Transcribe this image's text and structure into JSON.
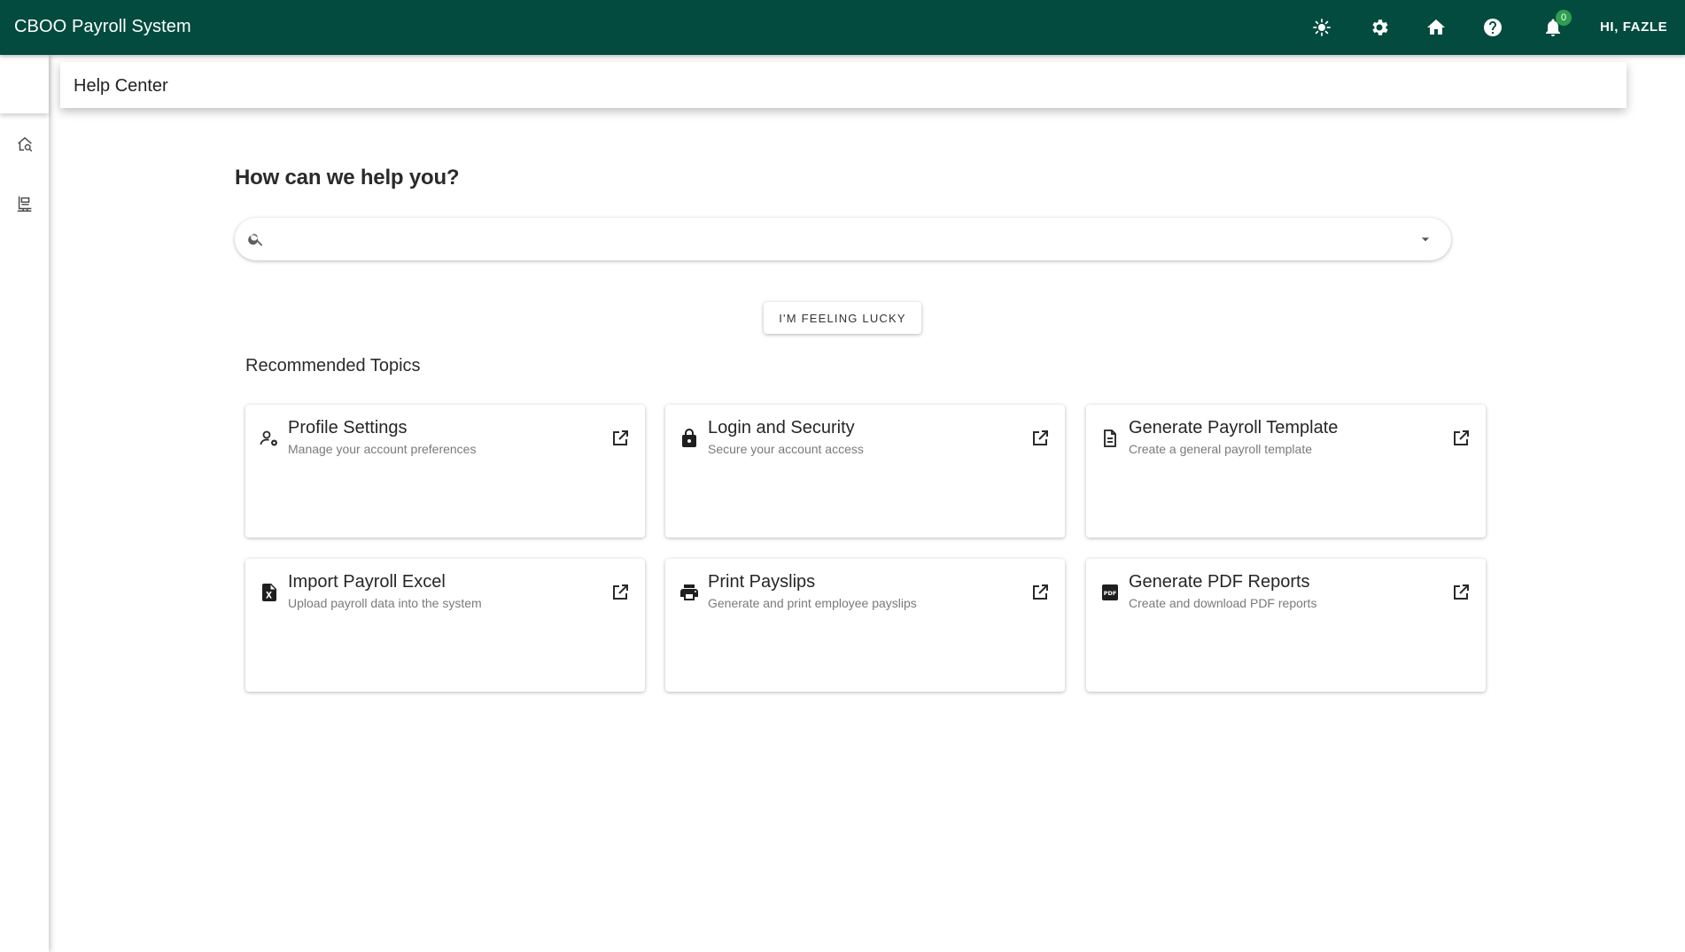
{
  "app": {
    "title": "CBOO Payroll System",
    "brand_color": "#024b3e"
  },
  "topbar": {
    "icons": [
      "theme-brightness-icon",
      "settings-gear-icon",
      "home-icon",
      "help-icon",
      "notifications-bell-icon"
    ],
    "notification_count": "0",
    "user_greeting": "HI, FAZLE"
  },
  "left_rail": {
    "icons": [
      "home-search-icon",
      "payroll-report-icon"
    ]
  },
  "breadcrumb": {
    "title": "Help Center"
  },
  "main": {
    "heading": "How can we help you?",
    "search": {
      "value": "",
      "placeholder": ""
    },
    "lucky_button_label": "I'M FEELING LUCKY",
    "topics_heading": "Recommended Topics",
    "topics": [
      {
        "title": "Profile Settings",
        "description": "Manage your account preferences",
        "icon": "profile-settings-icon"
      },
      {
        "title": "Login and Security",
        "description": "Secure your account access",
        "icon": "lock-icon"
      },
      {
        "title": "Generate Payroll Template",
        "description": "Create a general payroll template",
        "icon": "document-icon"
      },
      {
        "title": "Import Payroll Excel",
        "description": "Upload payroll data into the system",
        "icon": "excel-file-icon"
      },
      {
        "title": "Print Payslips",
        "description": "Generate and print employee payslips",
        "icon": "printer-icon"
      },
      {
        "title": "Generate PDF Reports",
        "description": "Create and download PDF reports",
        "icon": "pdf-icon"
      }
    ]
  }
}
